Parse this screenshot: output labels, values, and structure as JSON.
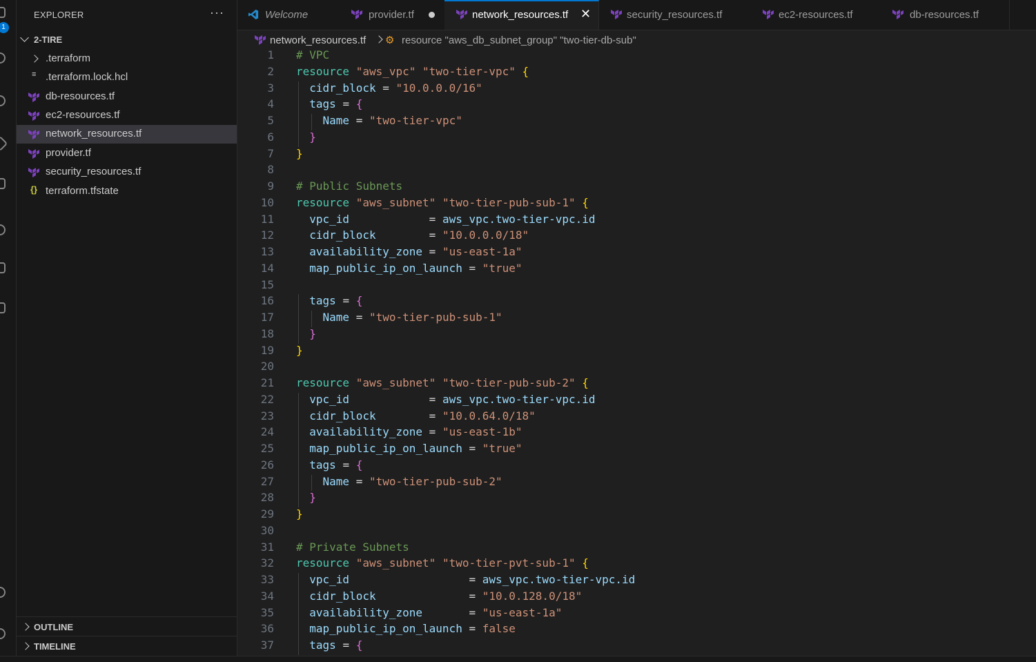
{
  "activity_bar": {
    "badge": "1"
  },
  "sidebar": {
    "title": "EXPLORER",
    "more": "···",
    "folder": "2-TIRE",
    "items": [
      {
        "label": ".terraform",
        "kind": "folder"
      },
      {
        "label": ".terraform.lock.hcl",
        "kind": "lines"
      },
      {
        "label": "db-resources.tf",
        "kind": "tf"
      },
      {
        "label": "ec2-resources.tf",
        "kind": "tf"
      },
      {
        "label": "network_resources.tf",
        "kind": "tf",
        "active": true
      },
      {
        "label": "provider.tf",
        "kind": "tf"
      },
      {
        "label": "security_resources.tf",
        "kind": "tf"
      },
      {
        "label": "terraform.tfstate",
        "kind": "json"
      }
    ],
    "outline": "OUTLINE",
    "timeline": "TIMELINE"
  },
  "tabs": [
    {
      "label": "Welcome"
    },
    {
      "label": "provider.tf"
    },
    {
      "label": "network_resources.tf"
    },
    {
      "label": "security_resources.tf"
    },
    {
      "label": "ec2-resources.tf"
    },
    {
      "label": "db-resources.tf"
    }
  ],
  "breadcrumb": {
    "file": "network_resources.tf",
    "symbol": "resource \"aws_db_subnet_group\" \"two-tier-db-sub\""
  },
  "colors": {
    "terraform_purple": "#7b42bc",
    "accent": "#0078d4"
  },
  "code": {
    "line_numbers": [
      "1",
      "2",
      "3",
      "4",
      "5",
      "6",
      "7",
      "8",
      "9",
      "10",
      "11",
      "12",
      "13",
      "14",
      "15",
      "16",
      "17",
      "18",
      "19",
      "20",
      "21",
      "22",
      "23",
      "24",
      "25",
      "26",
      "27",
      "28",
      "29",
      "30",
      "31",
      "32",
      "33",
      "34",
      "35",
      "36",
      "37"
    ],
    "lines": [
      "# VPC",
      "resource \"aws_vpc\" \"two-tier-vpc\" {",
      "  cidr_block = \"10.0.0.0/16\"",
      "  tags = {",
      "    Name = \"two-tier-vpc\"",
      "  }",
      "}",
      "",
      "# Public Subnets",
      "resource \"aws_subnet\" \"two-tier-pub-sub-1\" {",
      "  vpc_id            = aws_vpc.two-tier-vpc.id",
      "  cidr_block        = \"10.0.0.0/18\"",
      "  availability_zone = \"us-east-1a\"",
      "  map_public_ip_on_launch = \"true\"",
      "",
      "  tags = {",
      "    Name = \"two-tier-pub-sub-1\"",
      "  }",
      "}",
      "",
      "resource \"aws_subnet\" \"two-tier-pub-sub-2\" {",
      "  vpc_id            = aws_vpc.two-tier-vpc.id",
      "  cidr_block        = \"10.0.64.0/18\"",
      "  availability_zone = \"us-east-1b\"",
      "  map_public_ip_on_launch = \"true\"",
      "  tags = {",
      "    Name = \"two-tier-pub-sub-2\"",
      "  }",
      "}",
      "",
      "# Private Subnets",
      "resource \"aws_subnet\" \"two-tier-pvt-sub-1\" {",
      "  vpc_id                  = aws_vpc.two-tier-vpc.id",
      "  cidr_block              = \"10.0.128.0/18\"",
      "  availability_zone       = \"us-east-1a\"",
      "  map_public_ip_on_launch = false",
      "  tags = {"
    ]
  }
}
